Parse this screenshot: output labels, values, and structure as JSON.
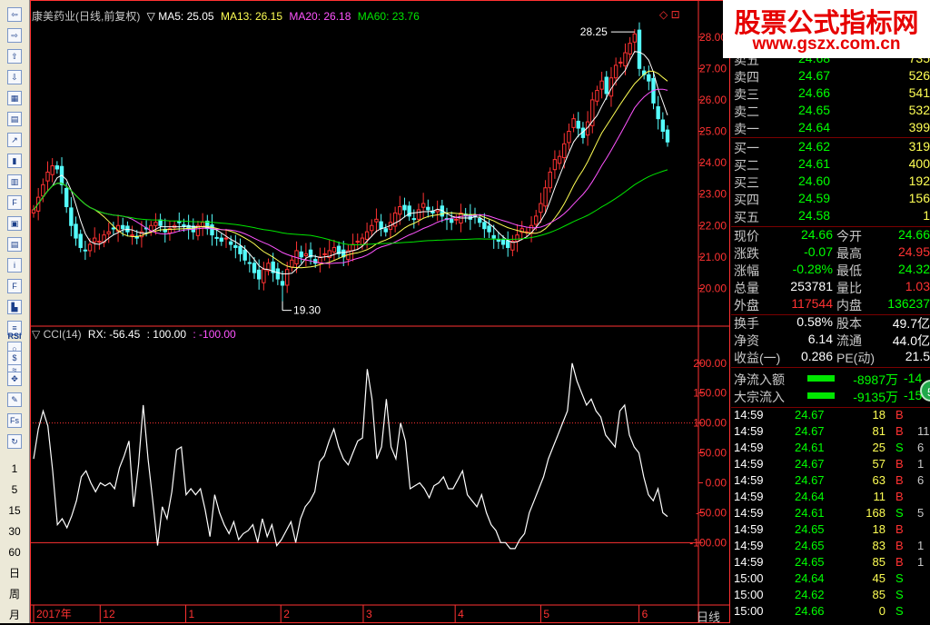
{
  "toolbar": {
    "icons": [
      "arrow-left-icon",
      "arrow-right-icon",
      "arrow-up-icon",
      "arrow-down-icon",
      "grid-icon",
      "table-icon",
      "line-chart-icon",
      "candle-chart-icon",
      "list-icon",
      "f10-icon",
      "calendar-icon",
      "report-icon",
      "info-icon",
      "f2-icon",
      "bar-icon",
      "rank-icon",
      "circle-icon",
      "wave-icon"
    ],
    "rsi_label": "RSI",
    "lower_icons": [
      "dollar-icon",
      "move-icon",
      "pen-icon",
      "fs-icon",
      "refresh-icon"
    ],
    "periods": [
      "1",
      "5",
      "15",
      "30",
      "60",
      "日",
      "周",
      "月"
    ]
  },
  "header": {
    "stock": "康美药业(日线,前复权)",
    "ma5": "▽ MA5: 25.05",
    "ma13": "MA13: 26.15",
    "ma20": "MA20: 26.18",
    "ma60": "MA60: 23.76",
    "icons": "◇ ⊡"
  },
  "indicator": {
    "cci": "▽ CCI(14)",
    "rx": "RX: -56.45",
    "upper": ": 100.00",
    "lower": ": -100.00"
  },
  "bottom": {
    "period_label": "日线"
  },
  "colors": {
    "up": "#ff3232",
    "down": "#54fcfc",
    "ma5": "#ffffff",
    "ma13": "#ffff54",
    "ma20": "#ff54ff",
    "ma60": "#00e600",
    "axis": "#ff3232",
    "grid": "#7a0000",
    "cci": "#ffffff"
  },
  "chart_data": [
    {
      "type": "candlestick",
      "title": "康美药业(日线,前复权)",
      "x_labels": [
        "2017年",
        "12",
        "1",
        "2",
        "3",
        "4",
        "5",
        "6"
      ],
      "y_ticks": [
        "28.00",
        "27.00",
        "26.00",
        "25.00",
        "24.00",
        "23.00",
        "22.00",
        "21.00",
        "20.00"
      ],
      "ylim": [
        19.0,
        28.6
      ],
      "annotations": [
        {
          "text": "28.25",
          "value": 28.25
        },
        {
          "text": "19.30",
          "value": 19.3
        }
      ],
      "closes": [
        22.5,
        22.9,
        23.3,
        23.7,
        23.9,
        23.8,
        23.3,
        22.6,
        22.0,
        21.6,
        21.3,
        21.2,
        21.4,
        21.6,
        21.5,
        21.7,
        21.8,
        21.9,
        22.0,
        21.9,
        21.8,
        21.7,
        21.6,
        21.8,
        21.9,
        22.0,
        22.1,
        22.0,
        21.8,
        21.9,
        22.0,
        22.1,
        22.0,
        21.9,
        21.8,
        22.0,
        22.1,
        21.9,
        21.7,
        21.6,
        21.5,
        21.6,
        21.4,
        21.3,
        21.1,
        20.9,
        20.8,
        20.5,
        20.3,
        20.6,
        20.8,
        20.5,
        20.3,
        20.1,
        20.6,
        20.9,
        21.2,
        21.0,
        21.1,
        21.0,
        20.8,
        21.0,
        21.1,
        21.2,
        21.3,
        21.1,
        21.0,
        21.2,
        21.4,
        21.5,
        21.6,
        21.8,
        22.0,
        22.2,
        21.9,
        21.8,
        22.1,
        22.4,
        22.6,
        22.5,
        22.3,
        22.2,
        22.5,
        22.7,
        22.5,
        22.4,
        22.5,
        22.3,
        22.2,
        22.1,
        22.2,
        22.4,
        22.3,
        22.2,
        22.3,
        22.1,
        21.9,
        21.8,
        21.6,
        21.5,
        21.4,
        21.3,
        21.5,
        21.7,
        21.9,
        21.8,
        22.0,
        22.3,
        22.7,
        23.2,
        23.7,
        24.1,
        24.2,
        24.6,
        25.0,
        25.4,
        25.1,
        24.8,
        25.3,
        26.0,
        26.3,
        26.6,
        26.2,
        26.7,
        27.1,
        27.2,
        27.5,
        27.8,
        28.1,
        27.0,
        26.8,
        26.6,
        25.9,
        25.4,
        25.0,
        24.66
      ],
      "series": [
        {
          "name": "MA5",
          "final": 25.05
        },
        {
          "name": "MA13",
          "final": 26.15
        },
        {
          "name": "MA20",
          "final": 26.18
        },
        {
          "name": "MA60",
          "final": 23.76
        }
      ]
    },
    {
      "type": "line",
      "title": "CCI(14)",
      "y_ticks": [
        "200.00",
        "150.00",
        "100.00",
        "50.00",
        "0.00",
        "-50.00",
        "-100.00"
      ],
      "ylim": [
        -180,
        230
      ],
      "reference_lines": [
        100,
        -100
      ],
      "series": [
        {
          "name": "RX",
          "values": [
            40,
            90,
            120,
            95,
            20,
            -70,
            -60,
            -75,
            -55,
            -30,
            10,
            20,
            0,
            -15,
            0,
            -5,
            0,
            -10,
            25,
            45,
            70,
            -40,
            30,
            130,
            40,
            -30,
            -105,
            -40,
            -60,
            -15,
            55,
            60,
            -20,
            -10,
            -20,
            -10,
            -45,
            -90,
            -20,
            -50,
            -70,
            -85,
            -65,
            -95,
            -85,
            -80,
            -70,
            -100,
            -60,
            -90,
            -70,
            -105,
            -95,
            -80,
            -65,
            -100,
            -60,
            -40,
            -30,
            -15,
            35,
            45,
            70,
            90,
            60,
            40,
            30,
            50,
            70,
            75,
            190,
            140,
            40,
            60,
            140,
            60,
            40,
            100,
            70,
            -10,
            -5,
            0,
            -10,
            -25,
            -5,
            0,
            10,
            -10,
            -10,
            5,
            20,
            -20,
            -30,
            -40,
            -20,
            -50,
            -70,
            -80,
            -100,
            -100,
            -110,
            -110,
            -95,
            -85,
            -50,
            -30,
            -10,
            10,
            40,
            60,
            80,
            100,
            120,
            200,
            170,
            150,
            130,
            140,
            120,
            110,
            80,
            70,
            60,
            120,
            130,
            80,
            60,
            50,
            10,
            -20,
            -30,
            -10,
            -50,
            -56.45
          ]
        }
      ]
    }
  ],
  "right_panel": {
    "asks": [
      {
        "label": "卖五",
        "price": "24.68",
        "vol": "735"
      },
      {
        "label": "卖四",
        "price": "24.67",
        "vol": "526"
      },
      {
        "label": "卖三",
        "price": "24.66",
        "vol": "541"
      },
      {
        "label": "卖二",
        "price": "24.65",
        "vol": "532"
      },
      {
        "label": "卖一",
        "price": "24.64",
        "vol": "399"
      }
    ],
    "bids": [
      {
        "label": "买一",
        "price": "24.62",
        "vol": "319"
      },
      {
        "label": "买二",
        "price": "24.61",
        "vol": "400"
      },
      {
        "label": "买三",
        "price": "24.60",
        "vol": "192"
      },
      {
        "label": "买四",
        "price": "24.59",
        "vol": "156"
      },
      {
        "label": "买五",
        "price": "24.58",
        "vol": "1"
      }
    ],
    "stats": [
      {
        "k1": "现价",
        "v1": "24.66",
        "k2": "今开",
        "v2": "24.66"
      },
      {
        "k1": "涨跌",
        "v1": "-0.07",
        "k2": "最高",
        "v2": "24.95"
      },
      {
        "k1": "涨幅",
        "v1": "-0.28%",
        "k2": "最低",
        "v2": "24.32"
      },
      {
        "k1": "总量",
        "v1": "253781",
        "k2": "量比",
        "v2": "1.03"
      },
      {
        "k1": "外盘",
        "v1": "117544",
        "k2": "内盘",
        "v2": "136237"
      }
    ],
    "stats2": [
      {
        "k1": "换手",
        "v1": "0.58%",
        "k2": "股本",
        "v2": "49.7亿"
      },
      {
        "k1": "净资",
        "v1": "6.14",
        "k2": "流通",
        "v2": "44.0亿"
      },
      {
        "k1": "收益(一)",
        "v1": "0.286",
        "k2": "PE(动)",
        "v2": "21.5"
      }
    ],
    "flows": [
      {
        "label": "净流入额",
        "value": "-8987万",
        "tail": "-14"
      },
      {
        "label": "大宗流入",
        "value": "-9135万",
        "tail": "-15"
      }
    ],
    "ticks": [
      {
        "t": "14:59",
        "p": "24.67",
        "v": "18",
        "s": "B",
        "x": ""
      },
      {
        "t": "14:59",
        "p": "24.67",
        "v": "81",
        "s": "B",
        "x": "11"
      },
      {
        "t": "14:59",
        "p": "24.61",
        "v": "25",
        "s": "S",
        "x": "6"
      },
      {
        "t": "14:59",
        "p": "24.67",
        "v": "57",
        "s": "B",
        "x": "1"
      },
      {
        "t": "14:59",
        "p": "24.67",
        "v": "63",
        "s": "B",
        "x": "6"
      },
      {
        "t": "14:59",
        "p": "24.64",
        "v": "11",
        "s": "B",
        "x": ""
      },
      {
        "t": "14:59",
        "p": "24.61",
        "v": "168",
        "s": "S",
        "x": "5"
      },
      {
        "t": "14:59",
        "p": "24.65",
        "v": "18",
        "s": "B",
        "x": ""
      },
      {
        "t": "14:59",
        "p": "24.65",
        "v": "83",
        "s": "B",
        "x": "1"
      },
      {
        "t": "14:59",
        "p": "24.65",
        "v": "85",
        "s": "B",
        "x": "1"
      },
      {
        "t": "15:00",
        "p": "24.64",
        "v": "45",
        "s": "S",
        "x": ""
      },
      {
        "t": "15:00",
        "p": "24.62",
        "v": "85",
        "s": "S",
        "x": ""
      },
      {
        "t": "15:00",
        "p": "24.66",
        "v": "0",
        "s": "S",
        "x": ""
      }
    ],
    "badge": "5"
  },
  "watermark": {
    "title": "股票公式指标网",
    "url": "www.gszx.com.cn"
  }
}
